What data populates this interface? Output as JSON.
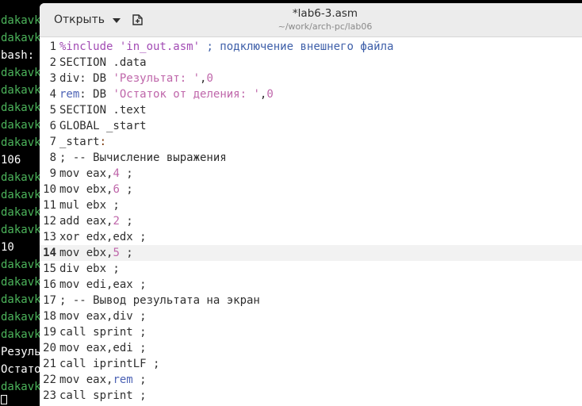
{
  "terminal": {
    "lines": [
      {
        "text": "dakavk",
        "color": "green"
      },
      {
        "text": "dakavk",
        "color": "green"
      },
      {
        "text": "bash: ",
        "color": "white"
      },
      {
        "text": "dakavk",
        "color": "green"
      },
      {
        "text": "dakavk",
        "color": "green"
      },
      {
        "text": "dakavk",
        "color": "green"
      },
      {
        "text": "dakavk",
        "color": "green"
      },
      {
        "text": "dakavk",
        "color": "green"
      },
      {
        "text": "106",
        "color": "white"
      },
      {
        "text": "dakavk",
        "color": "green"
      },
      {
        "text": "dakavk",
        "color": "green"
      },
      {
        "text": "dakavk",
        "color": "green"
      },
      {
        "text": "dakavk",
        "color": "green"
      },
      {
        "text": "10",
        "color": "white"
      },
      {
        "text": "dakavk",
        "color": "green"
      },
      {
        "text": "dakavk",
        "color": "green"
      },
      {
        "text": "dakavk",
        "color": "green"
      },
      {
        "text": "dakavk",
        "color": "green"
      },
      {
        "text": "dakavk",
        "color": "green"
      },
      {
        "text": "Резуль",
        "color": "white"
      },
      {
        "text": "Остато",
        "color": "white"
      },
      {
        "text": "dakavk",
        "color": "green"
      }
    ]
  },
  "header": {
    "open_label": "Открыть",
    "title": "*lab6-3.asm",
    "path": "~/work/arch-pc/lab06"
  },
  "editor": {
    "current_line": 14,
    "lines": [
      {
        "n": "1",
        "tokens": [
          [
            "pre",
            "%include 'in_out.asm'"
          ],
          [
            "txt",
            " "
          ],
          [
            "cm",
            "; подключение внешнего файла"
          ]
        ]
      },
      {
        "n": "2",
        "tokens": [
          [
            "txt",
            "SECTION .data"
          ]
        ]
      },
      {
        "n": "3",
        "tokens": [
          [
            "txt",
            "div: DB "
          ],
          [
            "str",
            "'Результат: '"
          ],
          [
            "txt",
            ","
          ],
          [
            "num",
            "0"
          ]
        ]
      },
      {
        "n": "4",
        "tokens": [
          [
            "kw",
            "rem"
          ],
          [
            "txt",
            ": DB "
          ],
          [
            "str",
            "'Остаток от деления: '"
          ],
          [
            "txt",
            ","
          ],
          [
            "num",
            "0"
          ]
        ]
      },
      {
        "n": "5",
        "tokens": [
          [
            "txt",
            "SECTION .text"
          ]
        ]
      },
      {
        "n": "6",
        "tokens": [
          [
            "txt",
            "GLOBAL _start"
          ]
        ]
      },
      {
        "n": "7",
        "tokens": [
          [
            "txt",
            "_start"
          ],
          [
            "lbl",
            ":"
          ]
        ]
      },
      {
        "n": "8",
        "tokens": [
          [
            "txt",
            "; -- Вычисление выражения"
          ]
        ]
      },
      {
        "n": "9",
        "tokens": [
          [
            "txt",
            "mov eax,"
          ],
          [
            "num",
            "4"
          ],
          [
            "txt",
            " ;"
          ]
        ]
      },
      {
        "n": "10",
        "tokens": [
          [
            "txt",
            "mov ebx,"
          ],
          [
            "num",
            "6"
          ],
          [
            "txt",
            " ;"
          ]
        ]
      },
      {
        "n": "11",
        "tokens": [
          [
            "txt",
            "mul ebx ;"
          ]
        ]
      },
      {
        "n": "12",
        "tokens": [
          [
            "txt",
            "add eax,"
          ],
          [
            "num",
            "2"
          ],
          [
            "txt",
            " ;"
          ]
        ]
      },
      {
        "n": "13",
        "tokens": [
          [
            "txt",
            "xor edx,edx ;"
          ]
        ]
      },
      {
        "n": "14",
        "tokens": [
          [
            "txt",
            "mov ebx,"
          ],
          [
            "num",
            "5"
          ],
          [
            "txt",
            " ;"
          ]
        ]
      },
      {
        "n": "15",
        "tokens": [
          [
            "txt",
            "div ebx ;"
          ]
        ]
      },
      {
        "n": "16",
        "tokens": [
          [
            "txt",
            "mov edi,eax ;"
          ]
        ]
      },
      {
        "n": "17",
        "tokens": [
          [
            "txt",
            "; -- Вывод результата на экран"
          ]
        ]
      },
      {
        "n": "18",
        "tokens": [
          [
            "txt",
            "mov eax,div ;"
          ]
        ]
      },
      {
        "n": "19",
        "tokens": [
          [
            "txt",
            "call sprint ;"
          ]
        ]
      },
      {
        "n": "20",
        "tokens": [
          [
            "txt",
            "mov eax,edi ;"
          ]
        ]
      },
      {
        "n": "21",
        "tokens": [
          [
            "txt",
            "call iprintLF ;"
          ]
        ]
      },
      {
        "n": "22",
        "tokens": [
          [
            "txt",
            "mov eax,"
          ],
          [
            "kw",
            "rem"
          ],
          [
            "txt",
            " ;"
          ]
        ]
      },
      {
        "n": "23",
        "tokens": [
          [
            "txt",
            "call sprint ;"
          ]
        ]
      }
    ]
  },
  "colors": {
    "terminal_green": "#4cb45b",
    "comment": "#3e5fa9",
    "string": "#bf66aa",
    "preprocessor": "#a24bb4",
    "current_line": "#f2f2f2"
  }
}
